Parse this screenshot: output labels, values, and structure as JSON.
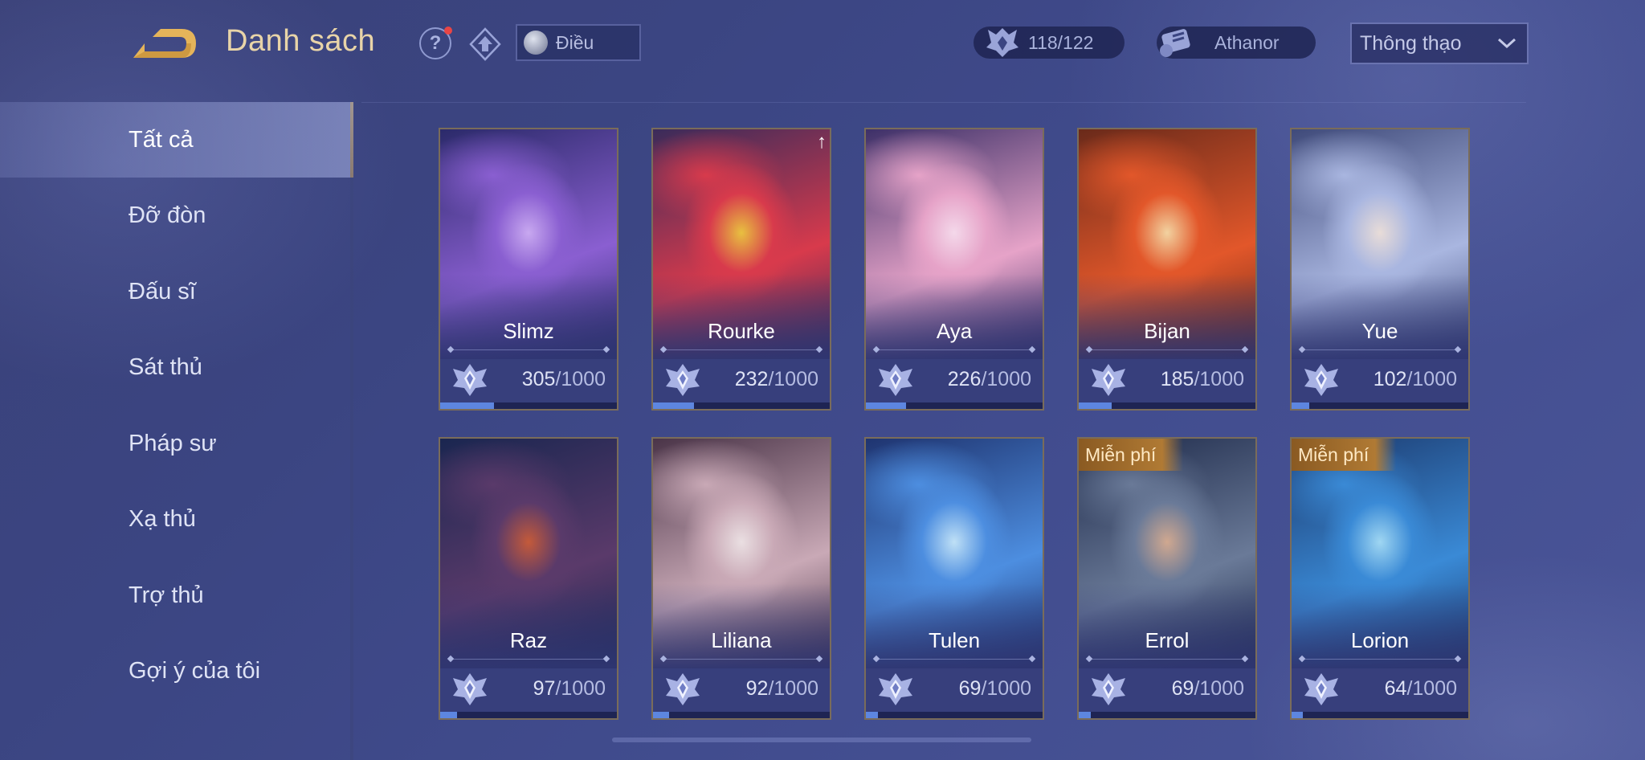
{
  "header": {
    "title": "Danh sách",
    "player_name": "Điều",
    "mastery_count": "118/122",
    "athanor_label": "Athanor",
    "sort_label": "Thông thạo"
  },
  "sidebar": {
    "items": [
      {
        "label": "Tất cả",
        "active": true
      },
      {
        "label": "Đỡ đòn",
        "active": false
      },
      {
        "label": "Đấu sĩ",
        "active": false
      },
      {
        "label": "Sát thủ",
        "active": false
      },
      {
        "label": "Pháp sư",
        "active": false
      },
      {
        "label": "Xạ thủ",
        "active": false
      },
      {
        "label": "Trợ thủ",
        "active": false
      },
      {
        "label": "Gợi ý của tôi",
        "active": false
      }
    ]
  },
  "heroes": [
    {
      "name": "Slimz",
      "points": "305",
      "max": "/1000",
      "progress": 0.305,
      "badge": "",
      "art": [
        "#2b2a6a",
        "#8a5fd1",
        "#c8a8f0"
      ]
    },
    {
      "name": "Rourke",
      "points": "232",
      "max": "/1000",
      "progress": 0.232,
      "badge": "",
      "art": [
        "#3a2b5a",
        "#d83a4c",
        "#e8c040"
      ],
      "new_arrow": "↑"
    },
    {
      "name": "Aya",
      "points": "226",
      "max": "/1000",
      "progress": 0.226,
      "badge": "",
      "art": [
        "#3d3068",
        "#e6a3c8",
        "#f4d8ea"
      ]
    },
    {
      "name": "Bijan",
      "points": "185",
      "max": "/1000",
      "progress": 0.185,
      "badge": "",
      "art": [
        "#6a2a1a",
        "#e2572a",
        "#f2d2a0"
      ]
    },
    {
      "name": "Yue",
      "points": "102",
      "max": "/1000",
      "progress": 0.102,
      "badge": "",
      "art": [
        "#3f4a7a",
        "#a9b6e0",
        "#e8dcd8"
      ]
    },
    {
      "name": "Raz",
      "points": "97",
      "max": "/1000",
      "progress": 0.097,
      "badge": "",
      "art": [
        "#1a2650",
        "#5a3a6a",
        "#c45a3a"
      ]
    },
    {
      "name": "Liliana",
      "points": "92",
      "max": "/1000",
      "progress": 0.092,
      "badge": "",
      "art": [
        "#4a3448",
        "#c9a9b6",
        "#eadfe2"
      ]
    },
    {
      "name": "Tulen",
      "points": "69",
      "max": "/1000",
      "progress": 0.069,
      "badge": "",
      "art": [
        "#1f3470",
        "#4d8ee0",
        "#bfe0f6"
      ]
    },
    {
      "name": "Errol",
      "points": "69",
      "max": "/1000",
      "progress": 0.069,
      "badge": "Miễn phí",
      "art": [
        "#1e2a4a",
        "#6a7a98",
        "#d0a890"
      ]
    },
    {
      "name": "Lorion",
      "points": "64",
      "max": "/1000",
      "progress": 0.064,
      "badge": "Miễn phí",
      "art": [
        "#1c3a6e",
        "#3a8ad6",
        "#9fd6f2"
      ]
    }
  ],
  "colors": {
    "accent_gold": "#e8d4a8",
    "progress_fill": "#5d86e0",
    "free_badge": "#b07a34"
  },
  "icons": {
    "back": "back-arrow-icon",
    "help": "question-icon",
    "rank": "rank-emblem-icon",
    "mastery": "mastery-crest-icon",
    "athanor": "athanor-scroll-icon",
    "sort": "chevron-down-icon",
    "card_emblem": "mastery-emblem-icon"
  }
}
